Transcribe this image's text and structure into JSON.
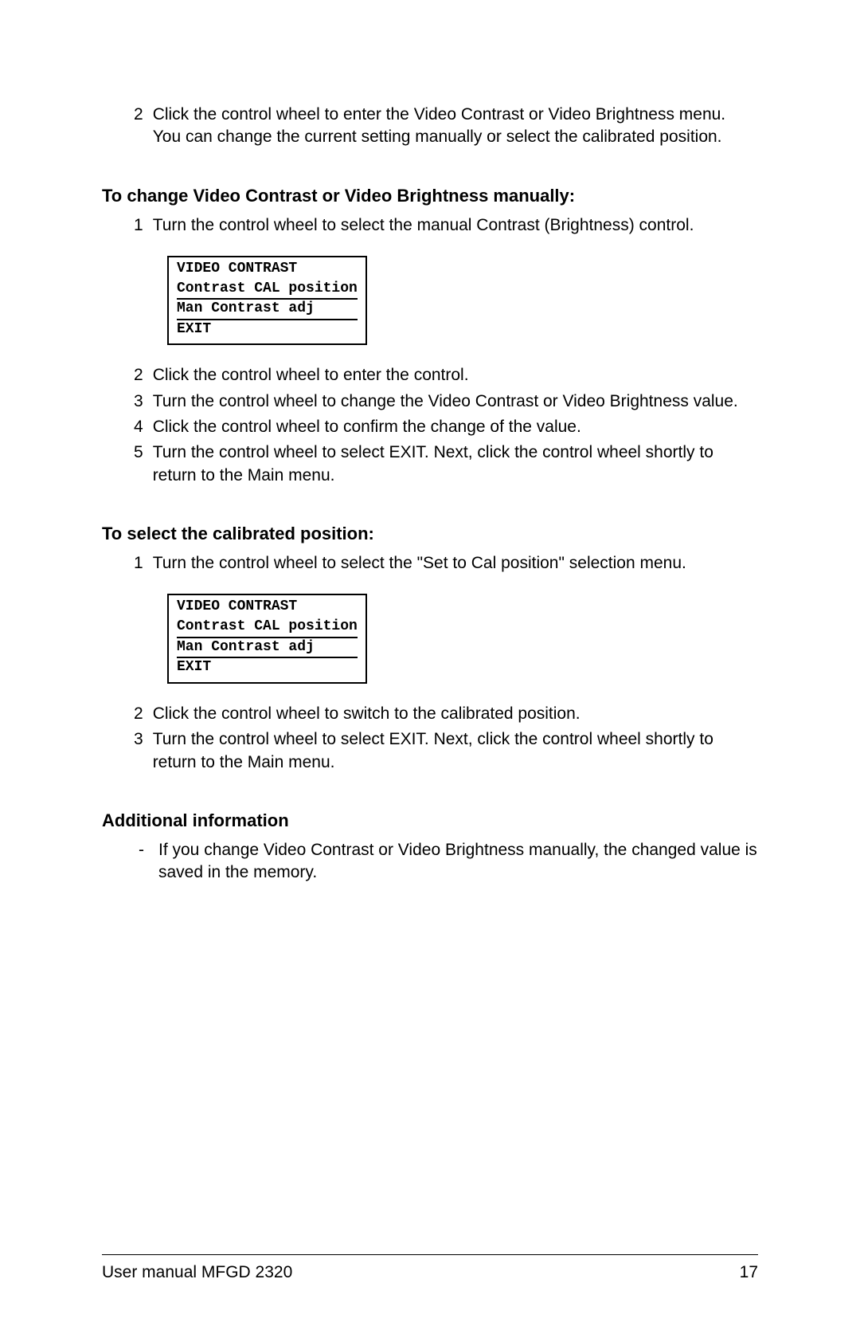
{
  "intro": {
    "step2_num": "2",
    "step2_text": "Click the control wheel to enter the Video Contrast or Video Brightness menu. You can change the current setting manually or select the calibrated position."
  },
  "section1": {
    "heading": "To change Video Contrast or Video Brightness manually:",
    "step1_num": "1",
    "step1_text": "Turn the control wheel to select the manual Contrast (Brightness) control.",
    "menu": {
      "title": "VIDEO CONTRAST",
      "line1": "Contrast CAL position",
      "line2": "Man Contrast adj",
      "line3": "EXIT"
    },
    "step2_num": "2",
    "step2_text": "Click the control wheel to enter the control.",
    "step3_num": "3",
    "step3_text": "Turn the control wheel to change the Video Contrast or Video Brightness value.",
    "step4_num": "4",
    "step4_text": "Click the control wheel to confirm the change of the value.",
    "step5_num": "5",
    "step5_text": "Turn the control wheel to select EXIT. Next, click the control wheel shortly to return to the Main menu."
  },
  "section2": {
    "heading": "To select the calibrated position:",
    "step1_num": "1",
    "step1_text": "Turn the control wheel to select the \"Set to Cal position\" selection menu.",
    "menu": {
      "title": "VIDEO CONTRAST",
      "line1": "Contrast CAL position",
      "line2": "Man Contrast adj",
      "line3": "EXIT"
    },
    "step2_num": "2",
    "step2_text": "Click the control wheel to switch to the calibrated position.",
    "step3_num": "3",
    "step3_text": "Turn the control wheel to select EXIT. Next, click the control wheel shortly to return to the Main menu."
  },
  "section3": {
    "heading": "Additional information",
    "bullet_marker": "-",
    "bullet_text": "If you change Video Contrast or Video Brightness manually, the changed value is saved in the memory."
  },
  "footer": {
    "left": "User manual MFGD 2320",
    "right": "17"
  }
}
